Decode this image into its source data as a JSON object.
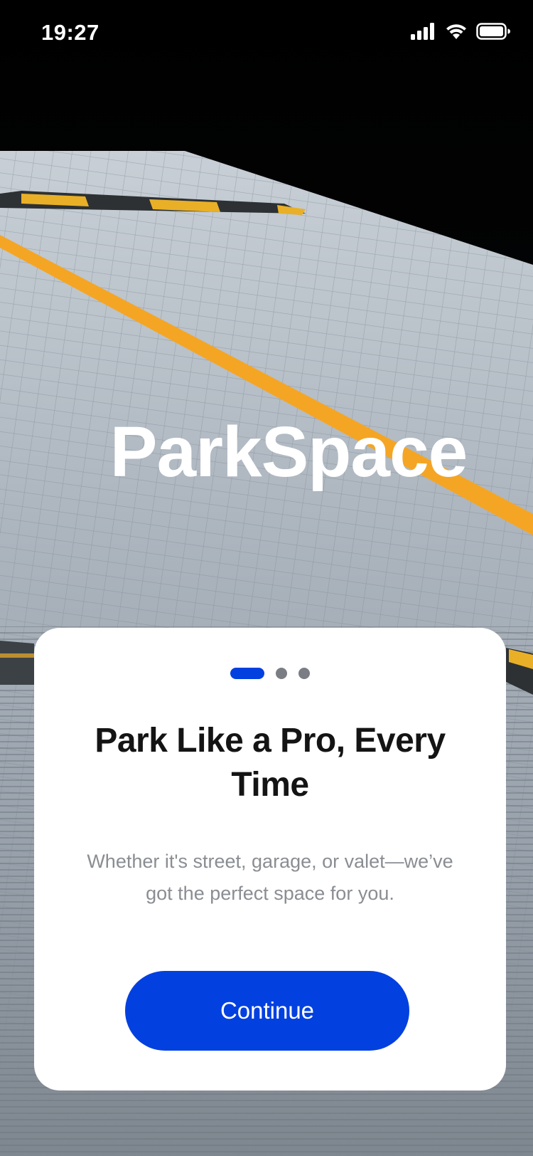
{
  "status_bar": {
    "time": "19:27",
    "icons": [
      "signal-icon",
      "wifi-icon",
      "battery-icon"
    ]
  },
  "app": {
    "title": "ParkSpace"
  },
  "onboarding": {
    "current_page": 1,
    "total_pages": 3,
    "title": "Park Like a Pro, Every Time",
    "subtitle": "Whether it's street, garage, or valet—we’ve got the perfect space for you.",
    "continue_label": "Continue"
  },
  "colors": {
    "accent": "#0340e0",
    "title_text": "#141414",
    "subtitle_text": "#8a8d92",
    "dot_inactive": "#7a7d83",
    "lane_stripe": "#f5a524",
    "card_background": "#ffffff"
  }
}
